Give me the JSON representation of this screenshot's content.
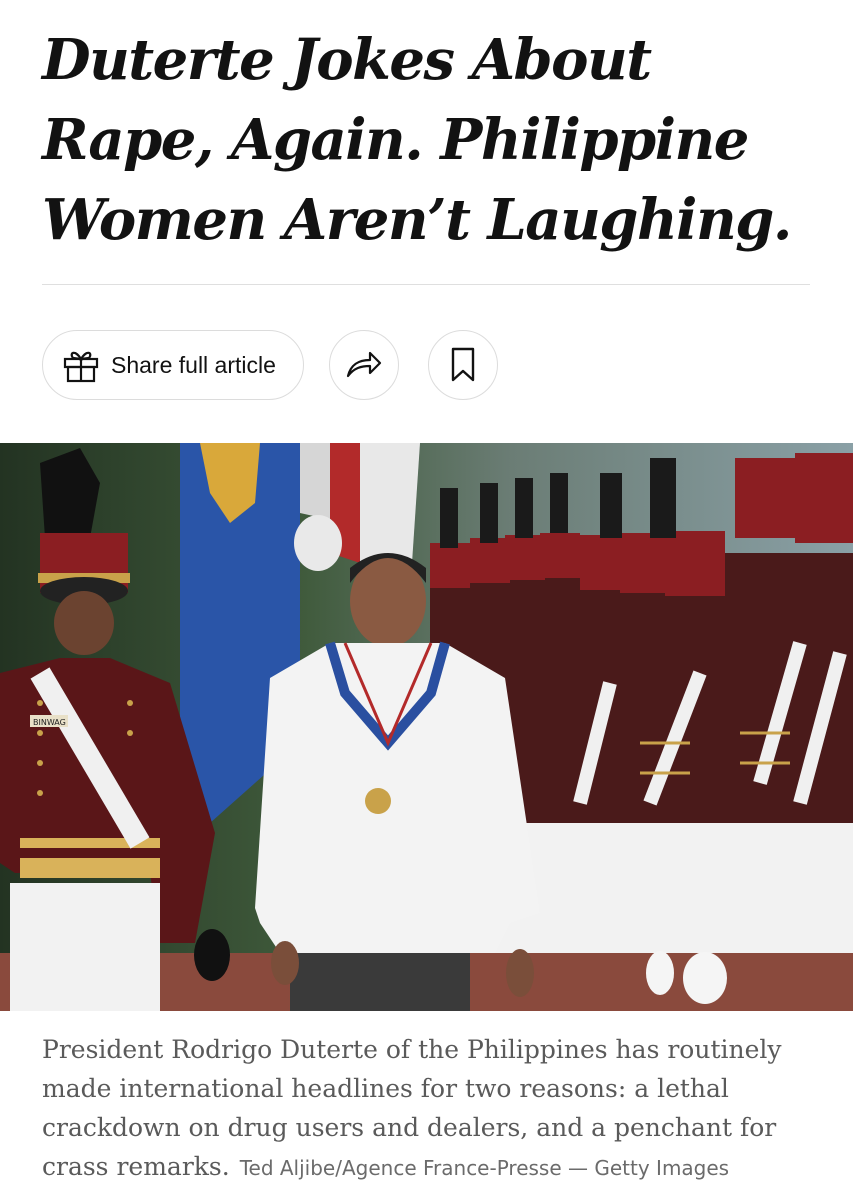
{
  "article": {
    "headline": "Duterte Jokes About Rape, Again. Philippine Women Aren’t Laughing."
  },
  "toolbar": {
    "share_label": "Share full article",
    "share_icon": "gift-icon",
    "forward_icon": "share-arrow-icon",
    "bookmark_icon": "bookmark-icon"
  },
  "photo": {
    "alt": "",
    "badge_text": "BINWAG"
  },
  "caption": {
    "text": "President Rodrigo Duterte of the Philippines has routinely made international headlines for two reasons: a lethal crackdown on drug users and dealers, and a penchant for crass remarks.",
    "credit": "Ted Aljibe/Agence France-Presse — Getty Images"
  },
  "colors": {
    "text": "#121212",
    "caption": "#5a5a5a",
    "border": "#dcdcdc",
    "uniform_maroon": "#6e1a1c",
    "uniform_white": "#f2f2f2",
    "flag_blue": "#2a55a8"
  }
}
